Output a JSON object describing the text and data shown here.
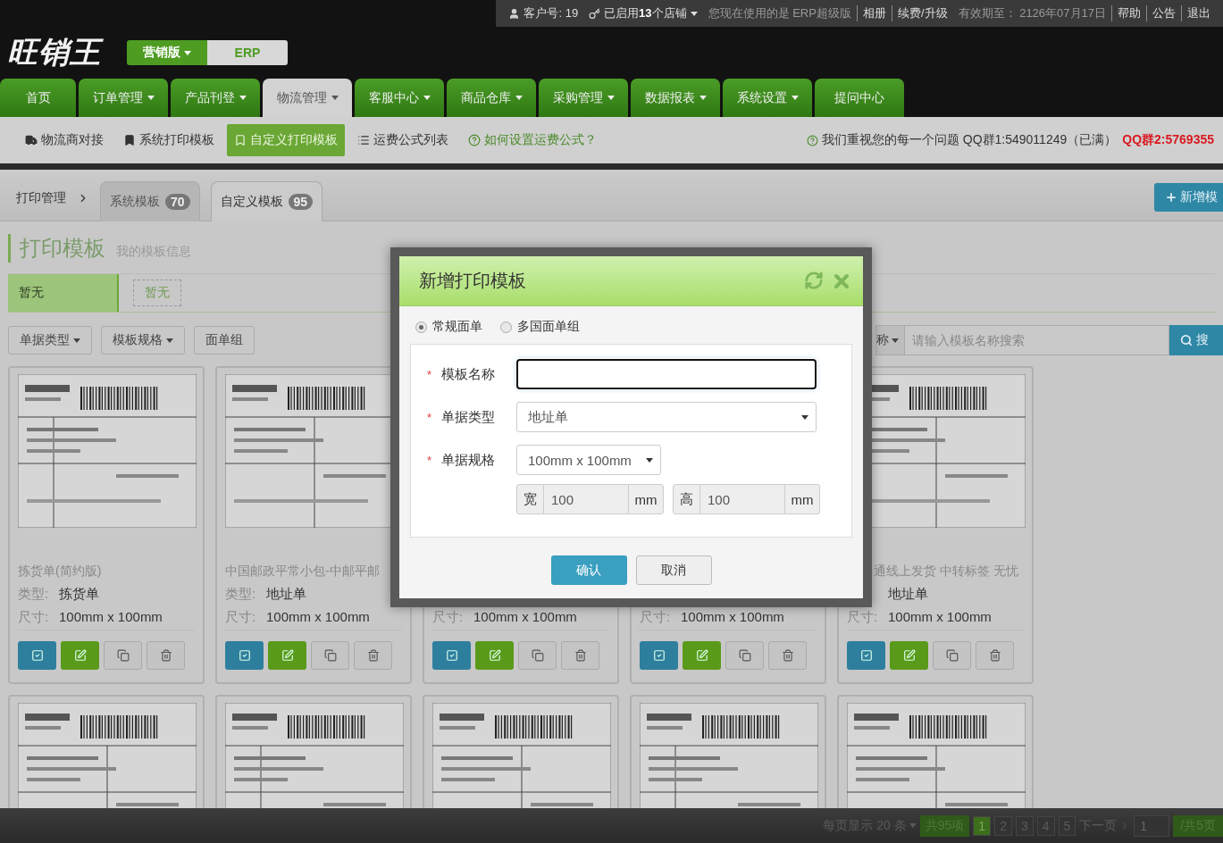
{
  "top_bar": {
    "items": [
      {
        "kind": "user",
        "text": "客户号: 19"
      },
      {
        "kind": "shops",
        "text": "已启用**13**个店铺"
      },
      {
        "kind": "note",
        "text": "您现在使用的是 ERP超级版"
      },
      {
        "kind": "link",
        "text": "相册"
      },
      {
        "kind": "link",
        "text": "续费/升级"
      },
      {
        "kind": "note",
        "text": "有效期至： 2126年07月17日"
      },
      {
        "kind": "link",
        "text": "帮助"
      },
      {
        "kind": "link",
        "text": "公告"
      },
      {
        "kind": "link",
        "text": "退出"
      }
    ]
  },
  "logo": "旺销王",
  "edition_switch": [
    {
      "label": "营销版",
      "selected": true,
      "dropdown": true
    },
    {
      "label": "ERP",
      "selected": false,
      "dropdown": false
    }
  ],
  "nav": [
    {
      "label": "首页",
      "selected": false,
      "dropdown": false
    },
    {
      "label": "订单管理",
      "selected": false,
      "dropdown": true
    },
    {
      "label": "产品刊登",
      "selected": false,
      "dropdown": true
    },
    {
      "label": "物流管理",
      "selected": true,
      "dropdown": true
    },
    {
      "label": "客服中心",
      "selected": false,
      "dropdown": true
    },
    {
      "label": "商品仓库",
      "selected": false,
      "dropdown": true
    },
    {
      "label": "采购管理",
      "selected": false,
      "dropdown": true
    },
    {
      "label": "数据报表",
      "selected": false,
      "dropdown": true
    },
    {
      "label": "系统设置",
      "selected": false,
      "dropdown": true
    },
    {
      "label": "提问中心",
      "selected": false,
      "dropdown": false
    }
  ],
  "subnav": {
    "items": [
      {
        "label": "物流商对接",
        "selected": false
      },
      {
        "label": "系统打印模板",
        "selected": false
      },
      {
        "label": "自定义打印模板",
        "selected": true
      },
      {
        "label": "运费公式列表",
        "selected": false
      },
      {
        "label": "如何设置运费公式？",
        "selected": false
      }
    ],
    "support_text": "我们重视您的每一个问题 QQ群1:549011249（已满）",
    "support_group": "QQ群2:5769355"
  },
  "breadcrumb": {
    "root": "打印管理",
    "tabs": [
      {
        "label": "系统模板",
        "count": "70",
        "selected": false
      },
      {
        "label": "自定义模板",
        "count": "95",
        "selected": true
      }
    ],
    "add_button": "新增模"
  },
  "section": {
    "title": "打印模板",
    "subtitle": "我的模板信息"
  },
  "categories": [
    {
      "label": "暂无",
      "selected": true
    },
    {
      "label": "暂无",
      "selected": false
    }
  ],
  "filters": [
    {
      "label": "单据类型",
      "dropdown": true
    },
    {
      "label": "模板规格",
      "dropdown": true
    },
    {
      "label": "面单组",
      "dropdown": false
    }
  ],
  "search": {
    "field": "称",
    "placeholder": "请输入模板名称搜索",
    "button": "搜"
  },
  "cards": [
    {
      "title": "拣货单(简约版)",
      "type_label": "类型:",
      "type": "拣货单",
      "size_label": "尺寸:",
      "size": "100mm x 100mm"
    },
    {
      "title": "中国邮政平常小包-中邮平邮",
      "type_label": "类型:",
      "type": "地址单",
      "size_label": "尺寸:",
      "size": "100mm x 100mm"
    },
    {
      "size_label": "尺寸:",
      "size": "100mm x 100mm"
    },
    {
      "size_label": "尺寸:",
      "size": "100mm x 100mm"
    },
    {
      "title": "通线上发货 中转标签 无忧",
      "type": "地址单",
      "size_label": "尺寸:",
      "size": "100mm x 100mm"
    }
  ],
  "pagination": {
    "per_page": "每页显示 20 条",
    "total": "共95项",
    "pages": [
      {
        "label": "1",
        "selected": true
      },
      {
        "label": "2",
        "selected": false
      },
      {
        "label": "3",
        "selected": false
      },
      {
        "label": "4",
        "selected": false
      },
      {
        "label": "5",
        "selected": false
      }
    ],
    "next": "下一页",
    "page_value": "1",
    "total_pages": "/共5页"
  },
  "modal": {
    "title": "新增打印模板",
    "radios": [
      {
        "label": "常规面单",
        "selected": true
      },
      {
        "label": "多国面单组",
        "selected": false
      }
    ],
    "fields": [
      {
        "kind": "text",
        "label": "模板名称",
        "required_mark": "*"
      },
      {
        "kind": "select",
        "label": "单据类型",
        "required_mark": "*",
        "value": "地址单"
      },
      {
        "kind": "select-short",
        "label": "单据规格",
        "required_mark": "*",
        "value": "100mm x 100mm"
      },
      {
        "kind": "dimensions",
        "parts": [
          {
            "prefix": "宽",
            "value": "100",
            "unit": "mm"
          },
          {
            "prefix": "高",
            "value": "100",
            "unit": "mm"
          }
        ]
      }
    ],
    "confirm": "确认",
    "cancel": "取消"
  }
}
